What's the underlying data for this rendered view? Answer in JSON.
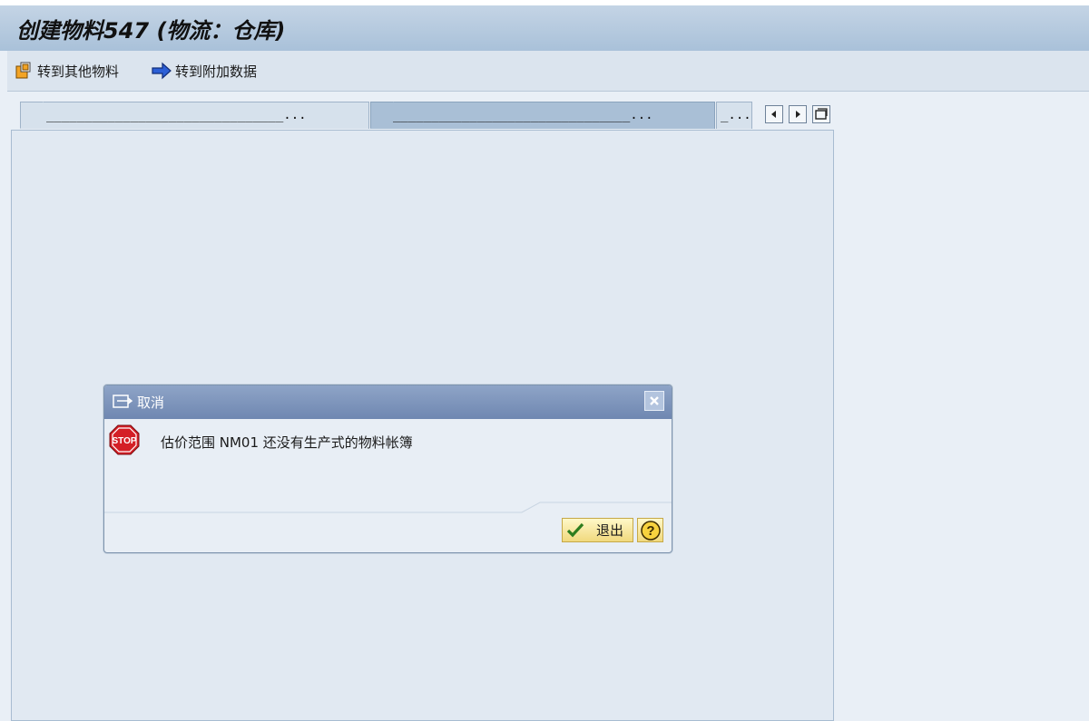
{
  "window": {
    "title": "创建物料547 (物流：仓库)"
  },
  "toolbar": {
    "other_material_label": "转到其他物料",
    "additional_data_label": "转到附加数据"
  },
  "tabs": [
    {
      "label": "_______________________________..."
    },
    {
      "label": "_______________________________..."
    },
    {
      "label": "_..."
    }
  ],
  "dialog": {
    "title": "取消",
    "message": "估价范围 NM01 还没有生产式的物料帐簿",
    "stop_icon_text": "STOP",
    "exit_label": "退出"
  }
}
